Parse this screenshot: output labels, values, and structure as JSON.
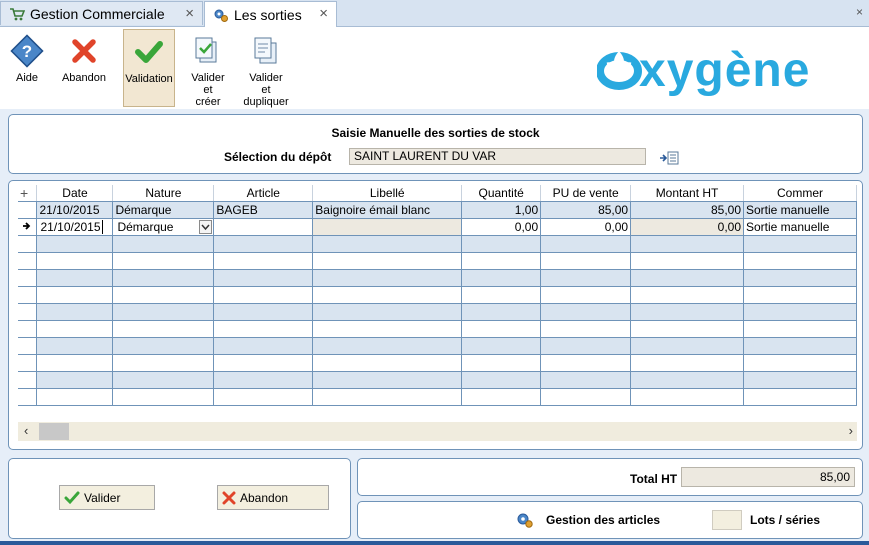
{
  "tabs": [
    {
      "label": "Gestion Commerciale",
      "close": "×"
    },
    {
      "label": "Les sorties",
      "close": "×"
    }
  ],
  "window_close": "×",
  "toolbar": {
    "aide": "Aide",
    "abandon": "Abandon",
    "validation": "Validation",
    "valider_creer": [
      "Valider",
      "et",
      "créer"
    ],
    "valider_dupliquer": [
      "Valider",
      "et",
      "dupliquer"
    ]
  },
  "logo": {
    "text": "oxygène",
    "color": "#29a9df"
  },
  "header": {
    "title": "Saisie Manuelle des sorties de stock",
    "depot_label": "Sélection du dépôt",
    "depot_value": "SAINT LAURENT DU VAR"
  },
  "grid": {
    "add_symbol": "+",
    "columns": [
      "Date",
      "Nature",
      "Article",
      "Libellé",
      "Quantité",
      "PU de vente",
      "Montant HT",
      "Commer"
    ],
    "rows": [
      {
        "date": "21/10/2015",
        "nature": "Démarque",
        "article": "BAGEB",
        "libelle": "Baignoire émail blanc",
        "quantite": "1,00",
        "pu": "85,00",
        "montant": "85,00",
        "comment": "Sortie manuelle"
      },
      {
        "date": "21/10/2015",
        "nature": "Démarque",
        "article": "",
        "libelle": "",
        "quantite": "0,00",
        "pu": "0,00",
        "montant": "0,00",
        "comment": "Sortie manuelle"
      }
    ],
    "empty_rows": 10
  },
  "scroll": {
    "left": "‹",
    "right": "›"
  },
  "buttons": {
    "valider": "Valider",
    "abandon": "Abandon"
  },
  "total": {
    "label": "Total HT",
    "value": "85,00"
  },
  "links": {
    "gestion": "Gestion des articles",
    "lots": "Lots / séries"
  },
  "colors": {
    "accent": "#6f93b8",
    "validate": "#3aa63a",
    "cancel": "#e0442a"
  }
}
